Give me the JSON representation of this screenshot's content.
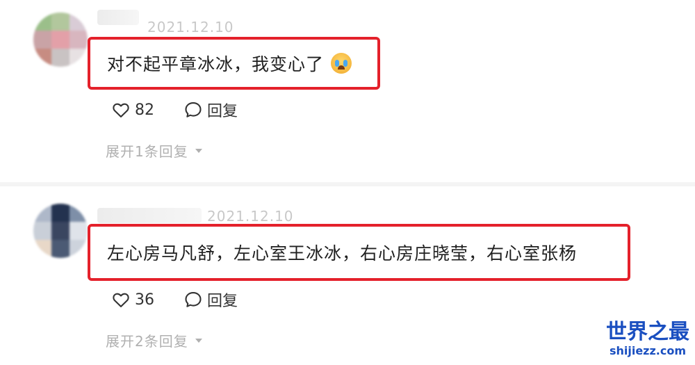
{
  "comments": [
    {
      "date": "2021.12.10",
      "text": "对不起平章冰冰，我变心了",
      "likes": "82",
      "reply_label": "回复",
      "expand_label": "展开1条回复",
      "avatar_colors": [
        "#9bbf8a",
        "#b2c79d",
        "#d9ccd6",
        "#c9a3a6",
        "#e3a0a8",
        "#d8b6bf",
        "#c78c82",
        "#c9c3c3",
        "#e7e1e3"
      ]
    },
    {
      "date": "2021.12.10",
      "text": "左心房马凡舒，左心室王冰冰，右心房庄晓莹，右心室张杨",
      "likes": "36",
      "reply_label": "回复",
      "expand_label": "展开2条回复",
      "avatar_colors": [
        "#aeb8c9",
        "#23324f",
        "#7e8fa8",
        "#c9cfd8",
        "#3a4660",
        "#dfe3ea",
        "#e8d8c8",
        "#4b5a74",
        "#cdd3dc"
      ]
    }
  ],
  "watermark": {
    "title": "世界之最",
    "url": "shijiezz.com"
  },
  "colors": {
    "highlight_border": "#e4212b",
    "watermark": "#1a4fc0"
  },
  "icons": {
    "like": "heart-icon",
    "reply": "speech-bubble-icon",
    "expand": "caret-down-icon"
  }
}
